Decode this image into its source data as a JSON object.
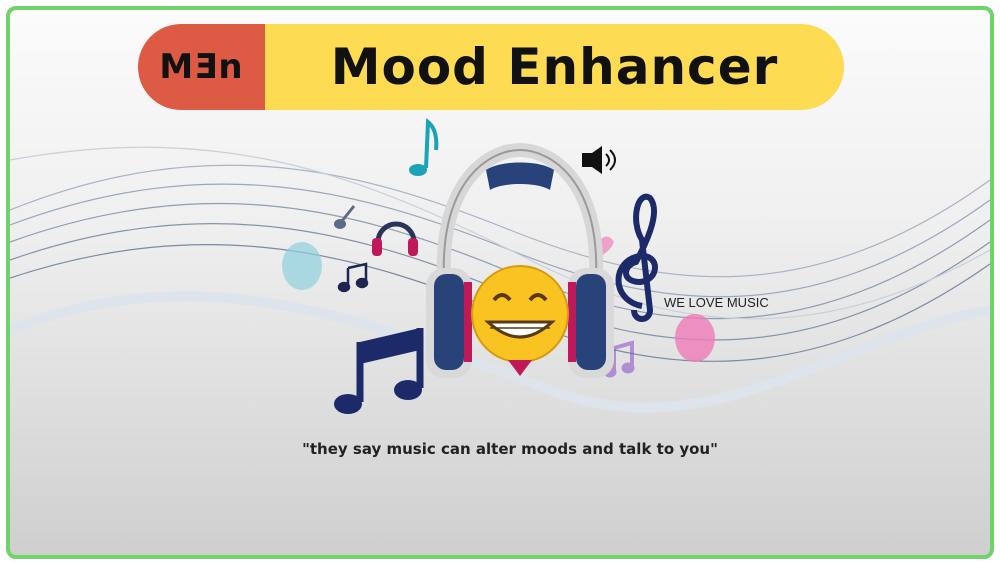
{
  "header": {
    "logo_text": "MƎn",
    "title": "Mood Enhancer"
  },
  "hero": {
    "badge_text": "WE LOVE MUSIC",
    "quote": "\"they say music can alter moods and talk to you\""
  },
  "colors": {
    "frame_border": "#6ed36a",
    "logo_bg": "#dd5a45",
    "title_bg": "#fddc54"
  }
}
